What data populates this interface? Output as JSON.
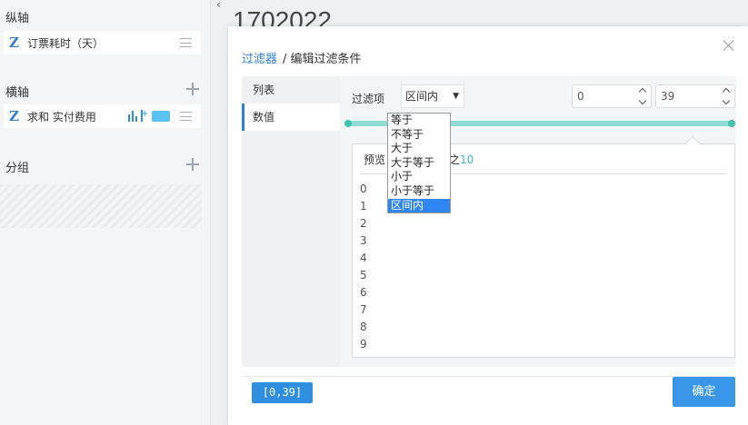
{
  "left_panel": {
    "y_axis": {
      "title": "纵轴",
      "field": "订票耗时（天）"
    },
    "x_axis": {
      "title": "横轴",
      "field": "求和 实付费用",
      "swatch_color": "#5ac2f0"
    },
    "group": {
      "title": "分组"
    }
  },
  "background_title": "1702022",
  "dialog": {
    "breadcrumb": {
      "root": "过滤器",
      "current": "/ 编辑过滤条件"
    },
    "tabs": [
      "列表",
      "数值"
    ],
    "active_tab": "数值",
    "filter": {
      "label": "过滤项",
      "selected": "区间内",
      "options": [
        "等于",
        "不等于",
        "大于",
        "大于等于",
        "小于",
        "小于等于",
        "区间内"
      ]
    },
    "range": {
      "min": "0",
      "max": "39",
      "slider_fill": 1.0
    },
    "preview": {
      "title_prefix": "预览",
      "title_suffix": "之",
      "count": "10",
      "values": [
        "0",
        "1",
        "2",
        "3",
        "4",
        "5",
        "6",
        "7",
        "8",
        "9"
      ]
    },
    "range_badge": "[0,39]",
    "confirm_label": "确定"
  },
  "colors": {
    "accent": "#2f7fd8",
    "slider": "#8fdcd0",
    "selected_option": "#2f86f2"
  }
}
